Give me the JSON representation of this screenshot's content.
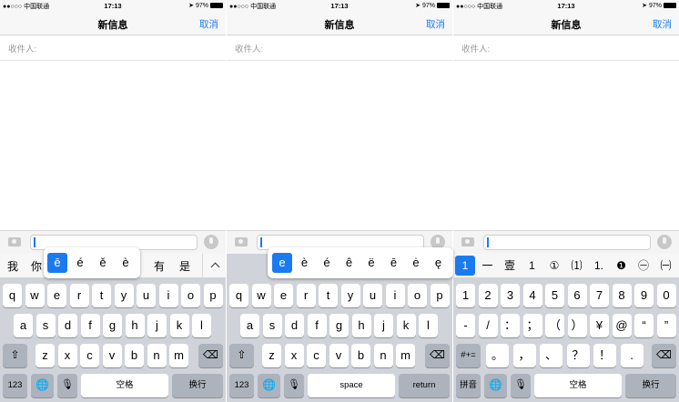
{
  "status": {
    "carrier": "●●○○○ 中国联通",
    "time": "17:13",
    "battery": "97%"
  },
  "nav": {
    "title": "新信息",
    "cancel": "取消"
  },
  "recipient_label": "收件人:",
  "panel1": {
    "candidates": [
      "我",
      "你",
      "有",
      "是"
    ],
    "accent_options": [
      "ē",
      "é",
      "ě",
      "è"
    ],
    "row1": [
      "q",
      "w",
      "e",
      "r",
      "t",
      "y",
      "u",
      "i",
      "o",
      "p"
    ],
    "row2": [
      "a",
      "s",
      "d",
      "f",
      "g",
      "h",
      "j",
      "k",
      "l"
    ],
    "row3": [
      "z",
      "x",
      "c",
      "v",
      "b",
      "n",
      "m"
    ],
    "mode_key": "123",
    "space_key": "空格",
    "return_key": "换行"
  },
  "panel2": {
    "accent_options": [
      "e",
      "è",
      "é",
      "ê",
      "ë",
      "ē",
      "ė",
      "ę"
    ],
    "row1": [
      "q",
      "w",
      "e",
      "r",
      "t",
      "y",
      "u",
      "i",
      "o",
      "p"
    ],
    "row2": [
      "a",
      "s",
      "d",
      "f",
      "g",
      "h",
      "j",
      "k",
      "l"
    ],
    "row3": [
      "z",
      "x",
      "c",
      "v",
      "b",
      "n",
      "m"
    ],
    "mode_key": "123",
    "space_key": "space",
    "return_key": "return"
  },
  "panel3": {
    "number_options": [
      "1",
      "一",
      "壹",
      "1",
      "①",
      "⑴",
      "1.",
      "❶",
      "㊀",
      "㈠"
    ],
    "row1": [
      "1",
      "2",
      "3",
      "4",
      "5",
      "6",
      "7",
      "8",
      "9",
      "0"
    ],
    "row2": [
      "-",
      "/",
      "：",
      "；",
      "（",
      "）",
      "¥",
      "@",
      "“",
      "”"
    ],
    "row3": [
      "。",
      "，",
      "、",
      "？",
      "！",
      "."
    ],
    "symbols_key": "#+=",
    "pinyin_key": "拼音",
    "space_key": "空格",
    "return_key": "换行"
  },
  "icons": [
    "wifi-icon",
    "location-icon",
    "battery-icon",
    "camera-icon",
    "mic-icon",
    "shift-icon",
    "backspace-icon",
    "globe-icon",
    "dictation-icon",
    "chevron-up-icon"
  ],
  "colors": {
    "accent": "#1a7bf0",
    "keyboard_bg": "#d0d3d9",
    "function_key": "#acb3bc"
  }
}
